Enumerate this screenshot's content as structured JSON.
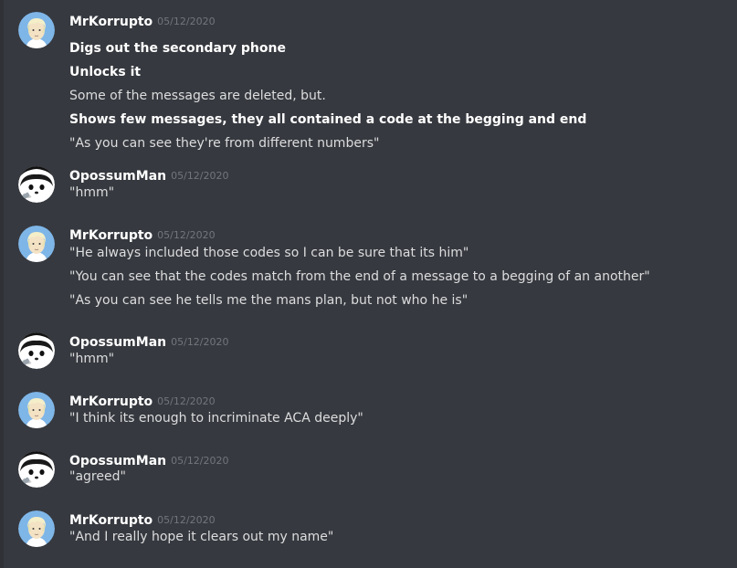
{
  "messages": [
    {
      "author": "MrKorrupto",
      "timestamp": "05/12/2020",
      "avatar": "blond-boy-avatar",
      "lines": [
        {
          "text": "Digs out the secondary phone",
          "bold": true
        },
        {
          "text": "Unlocks it",
          "bold": true
        },
        {
          "text": "Some of the messages are deleted, but.",
          "bold": false
        },
        {
          "text": "Shows few messages, they all contained a code at the begging and end",
          "bold": true
        },
        {
          "text": "\"As you can see they're from different numbers\"",
          "bold": false
        }
      ]
    },
    {
      "author": "OpossumMan",
      "timestamp": "05/12/2020",
      "avatar": "opossum-avatar",
      "lines": [
        {
          "text": "\"hmm\"",
          "bold": false
        }
      ]
    },
    {
      "author": "MrKorrupto",
      "timestamp": "05/12/2020",
      "avatar": "blond-boy-avatar",
      "lines": [
        {
          "text": "\"He always included those codes so I can be sure that its him\"",
          "bold": false
        },
        {
          "text": "\"You can see that the codes match from the end of a message to a begging of an another\"",
          "bold": false
        },
        {
          "text": "\"As you can see he tells me the mans plan, but not who he is\"",
          "bold": false
        }
      ]
    },
    {
      "author": "OpossumMan",
      "timestamp": "05/12/2020",
      "avatar": "opossum-avatar",
      "lines": [
        {
          "text": "\"hmm\"",
          "bold": false
        }
      ]
    },
    {
      "author": "MrKorrupto",
      "timestamp": "05/12/2020",
      "avatar": "blond-boy-avatar",
      "lines": [
        {
          "text": "\"I think its enough to incriminate ACA deeply\"",
          "bold": false
        }
      ]
    },
    {
      "author": "OpossumMan",
      "timestamp": "05/12/2020",
      "avatar": "opossum-avatar",
      "lines": [
        {
          "text": "\"agreed\"",
          "bold": false
        }
      ]
    },
    {
      "author": "MrKorrupto",
      "timestamp": "05/12/2020",
      "avatar": "blond-boy-avatar",
      "lines": [
        {
          "text": "\"And I really hope it clears out my name\"",
          "bold": false
        }
      ]
    }
  ],
  "colors": {
    "background": "#36393f",
    "author": "#ffffff",
    "timestamp": "#72767d",
    "text": "#dcddde"
  }
}
